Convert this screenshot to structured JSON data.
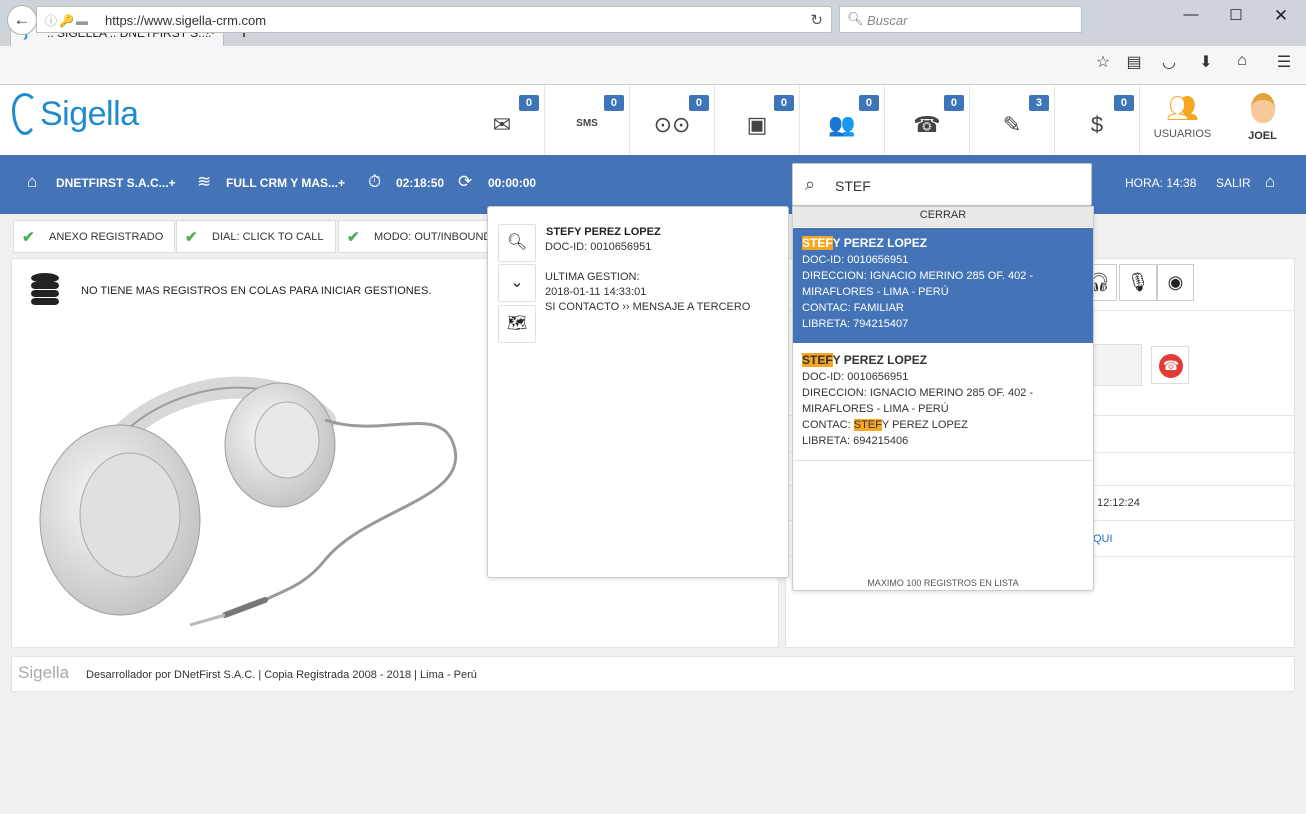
{
  "browser": {
    "tab_title": ":: SIGELLA :: DNETFIRST S....",
    "url": "https://www.sigella-crm.com",
    "search_placeholder": "Buscar"
  },
  "header": {
    "logo_text": "Sigella",
    "icons": [
      {
        "name": "email-icon",
        "glyph": "✉",
        "badge": "0"
      },
      {
        "name": "sms-icon",
        "glyph": "SMS",
        "badge": "0"
      },
      {
        "name": "voicemail-icon",
        "glyph": "⊙⊙",
        "badge": "0"
      },
      {
        "name": "notes-icon",
        "glyph": "▣",
        "badge": "0"
      },
      {
        "name": "contacts-icon",
        "glyph": "👥",
        "badge": "0"
      },
      {
        "name": "phone-icon",
        "glyph": "☎",
        "badge": "0"
      },
      {
        "name": "edit-icon",
        "glyph": "✎",
        "badge": "3"
      },
      {
        "name": "dollar-icon",
        "glyph": "$",
        "badge": "0"
      }
    ],
    "usuarios_label": "USUARIOS",
    "user_label": "JOEL"
  },
  "bluebar": {
    "company": "DNETFIRST S.A.C...+",
    "campaign": "FULL CRM Y MAS...+",
    "timer1": "02:18:50",
    "timer2": "00:00:00",
    "search_value": "STEF",
    "hora": "HORA: 14:38",
    "salir": "SALIR"
  },
  "status": [
    {
      "label": "ANEXO REGISTRADO"
    },
    {
      "label": "DIAL: CLICK TO CALL"
    },
    {
      "label": "MODO: OUT/INBOUND"
    }
  ],
  "left": {
    "message": "NO TIENE MAS REGISTROS EN COLAS PARA INICIAR GESTIONES."
  },
  "detail": {
    "name": "STEFY PEREZ LOPEZ",
    "doc": "DOC-ID: 0010656951",
    "ultima_label": "ULTIMA GESTION:",
    "ultima_date": "2018-01-11 14:33:01",
    "ultima_result": "SI CONTACTO ›› MENSAJE A TERCERO"
  },
  "results": {
    "close_label": "CERRAR",
    "items": [
      {
        "highlight": "STEF",
        "name_rest": "Y PEREZ LOPEZ",
        "doc": "DOC-ID: 0010656951",
        "dir1": "DIRECCION: IGNACIO MERINO 285 OF. 402 -",
        "dir2": "MIRAFLORES - LIMA - PERÚ",
        "contac_prefix": "CONTAC: FAMILIAR",
        "libreta": "LIBRETA: 794215407"
      },
      {
        "highlight": "STEF",
        "name_rest": "Y PEREZ LOPEZ",
        "doc": "DOC-ID: 0010656951",
        "dir1": "DIRECCION: IGNACIO MERINO 285 OF. 402 -",
        "dir2": "MIRAFLORES - LIMA - PERÚ",
        "contac_prefix": "CONTAC: ",
        "contac_highlight": "STEF",
        "contac_rest": "Y PEREZ LOPEZ",
        "libreta": "LIBRETA: 694215406"
      }
    ],
    "max_label": "MAXIMO 100 REGISTROS EN LISTA"
  },
  "right": {
    "time": "12:12:24",
    "link": "QUI"
  },
  "footer": {
    "logo": "Sigella",
    "text": "Desarrollador por DNetFirst S.A.C. | Copia Registrada 2008 - 2018 | Lima - Perú"
  },
  "colors": {
    "primary": "#4473b8",
    "highlight": "#f6a623",
    "logo": "#1e8bcf"
  }
}
